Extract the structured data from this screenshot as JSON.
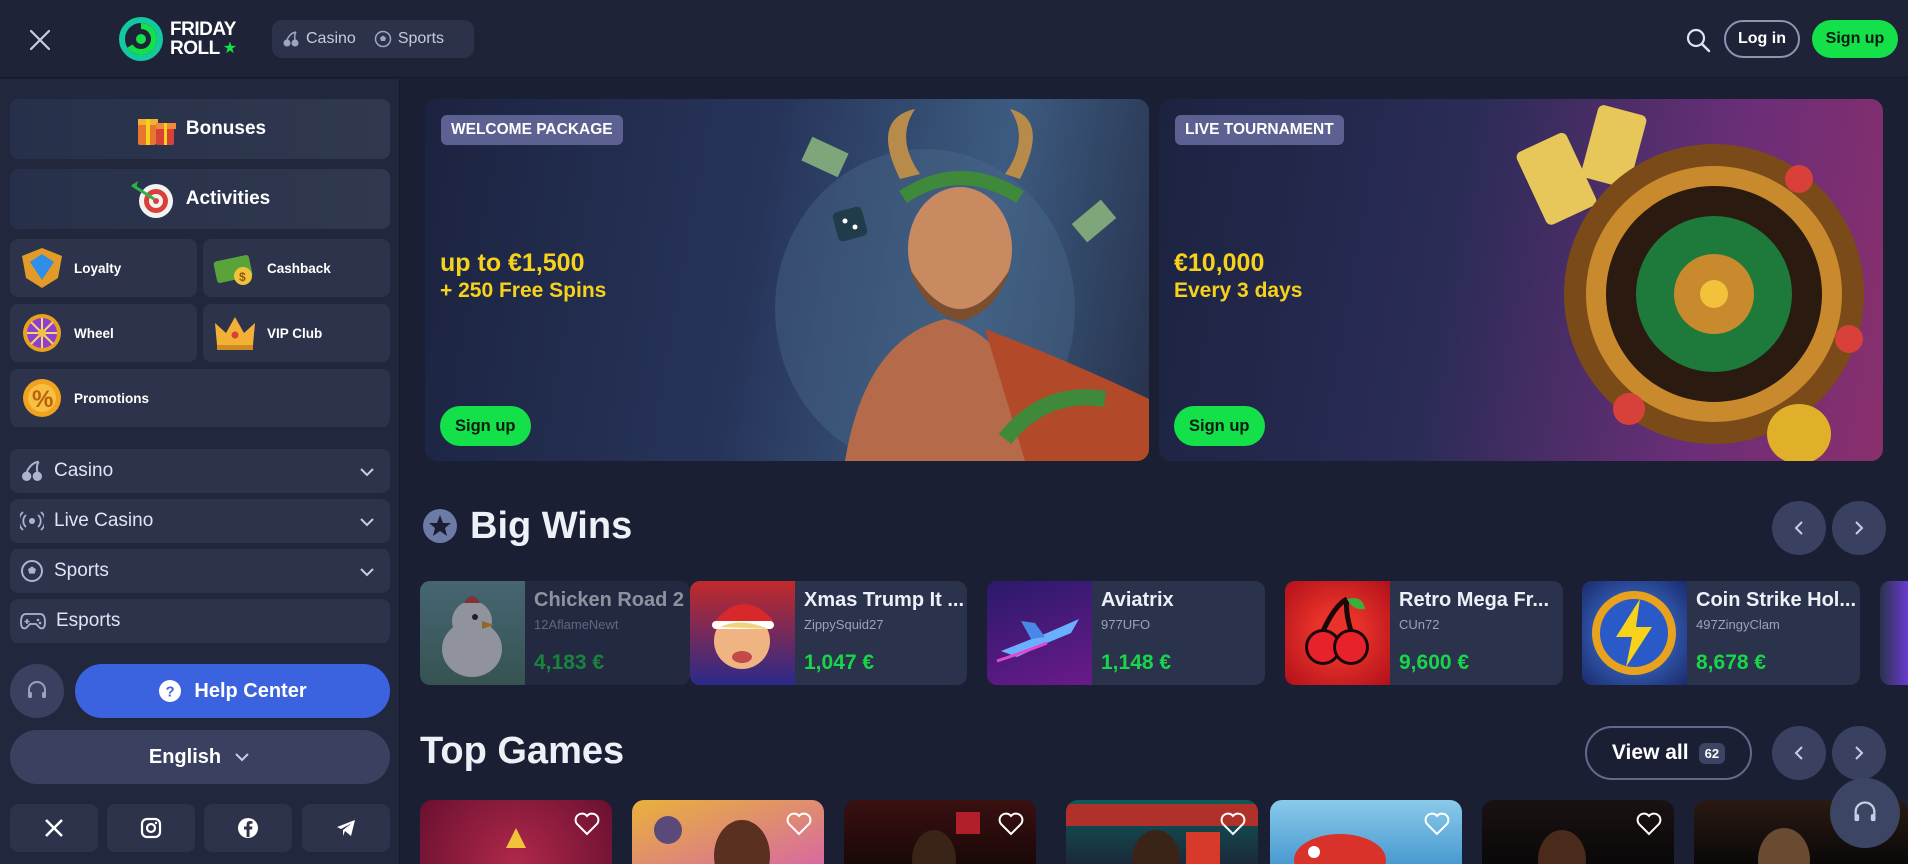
{
  "header": {
    "logo_line1": "FRIDAY",
    "logo_line2": "ROLL",
    "nav": [
      "Casino",
      "Sports"
    ],
    "login": "Log in",
    "signup": "Sign up"
  },
  "sidebar": {
    "bonuses": "Bonuses",
    "activities": "Activities",
    "tiles": [
      "Loyalty",
      "Cashback",
      "Wheel",
      "VIP Club",
      "Promotions"
    ],
    "menu": [
      "Casino",
      "Live Casino",
      "Sports",
      "Esports"
    ],
    "help": "Help Center",
    "language": "English"
  },
  "banners": [
    {
      "tag": "WELCOME PACKAGE",
      "line1": "up to €1,500",
      "line2": "+ 250 Free Spins",
      "cta": "Sign up"
    },
    {
      "tag": "LIVE TOURNAMENT",
      "line1": "€10,000",
      "line2": "Every 3 days",
      "cta": "Sign up"
    }
  ],
  "big_wins": {
    "title": "Big Wins",
    "items": [
      {
        "game": "Chicken Road 2",
        "user": "12AflameNewt",
        "amount": "4,183 €"
      },
      {
        "game": "Xmas Trump It ...",
        "user": "ZippySquid27",
        "amount": "1,047 €"
      },
      {
        "game": "Aviatrix",
        "user": "977UFO",
        "amount": "1,148 €"
      },
      {
        "game": "Retro Mega Fr...",
        "user": "CUn72",
        "amount": "9,600 €"
      },
      {
        "game": "Coin Strike Hol...",
        "user": "497ZingyClam",
        "amount": "8,678 €"
      }
    ]
  },
  "top_games": {
    "title": "Top Games",
    "view_all": "View all",
    "count": "62"
  },
  "colors": {
    "accent_green": "#14e04a",
    "help_blue": "#3b63e0",
    "promo_yellow": "#f7d21a"
  }
}
